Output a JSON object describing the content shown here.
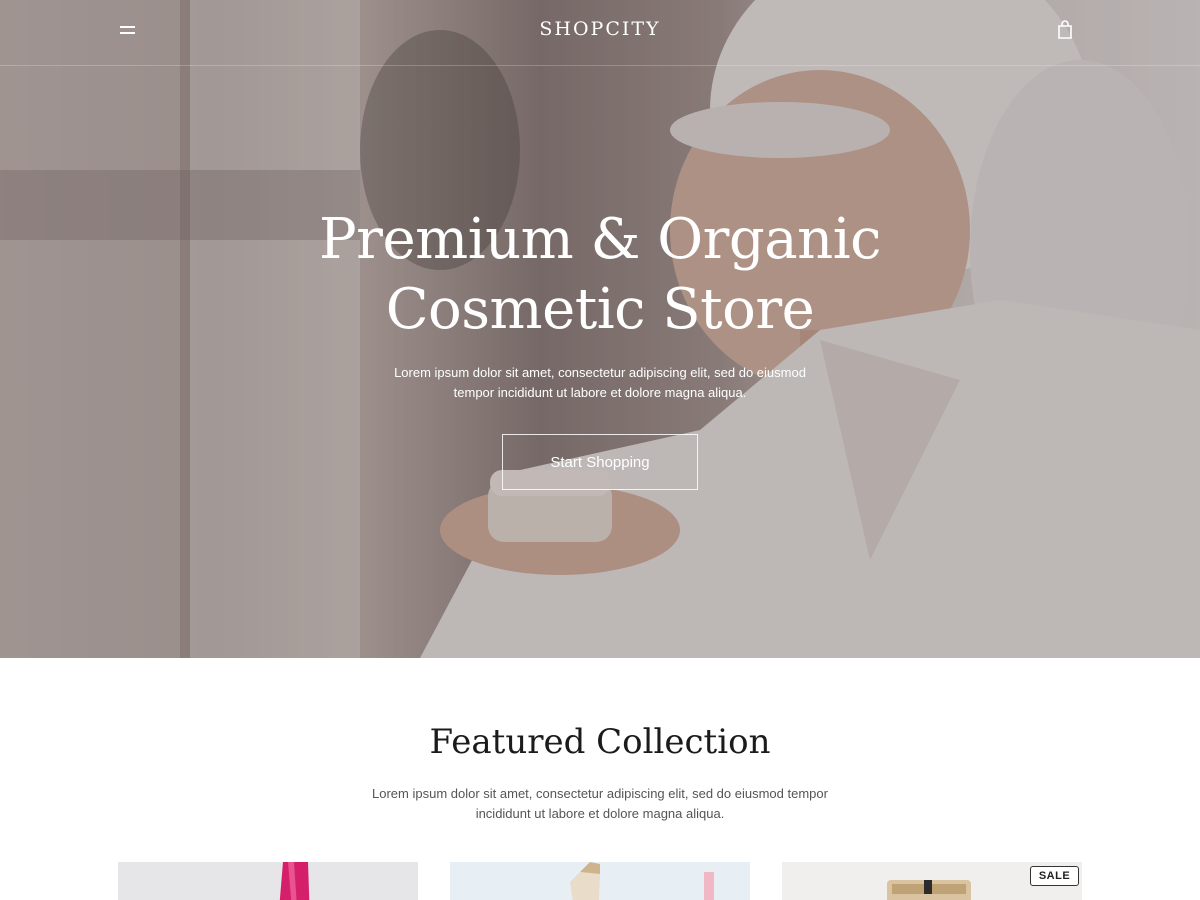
{
  "header": {
    "brand": "SHOPCITY",
    "menu_icon": "hamburger-menu-icon",
    "cart_icon": "shopping-bag-icon"
  },
  "hero": {
    "title_line1": "Premium & Organic",
    "title_line2": "Cosmetic Store",
    "subtitle_line1": "Lorem ipsum dolor sit amet, consectetur adipiscing elit, sed do eiusmod",
    "subtitle_line2": "tempor incididunt ut labore et dolore magna aliqua.",
    "cta_label": "Start Shopping"
  },
  "featured": {
    "title": "Featured Collection",
    "subtitle_line1": "Lorem ipsum dolor sit amet, consectetur adipiscing elit, sed do eiusmod tempor",
    "subtitle_line2": "incididunt ut labore et dolore magna aliqua.",
    "cards": [
      {
        "badge": ""
      },
      {
        "badge": ""
      },
      {
        "badge": "SALE"
      }
    ]
  },
  "colors": {
    "text_dark": "#1b1b1b",
    "hero_text": "#ffffff",
    "accent_pink": "#d61f6b"
  }
}
